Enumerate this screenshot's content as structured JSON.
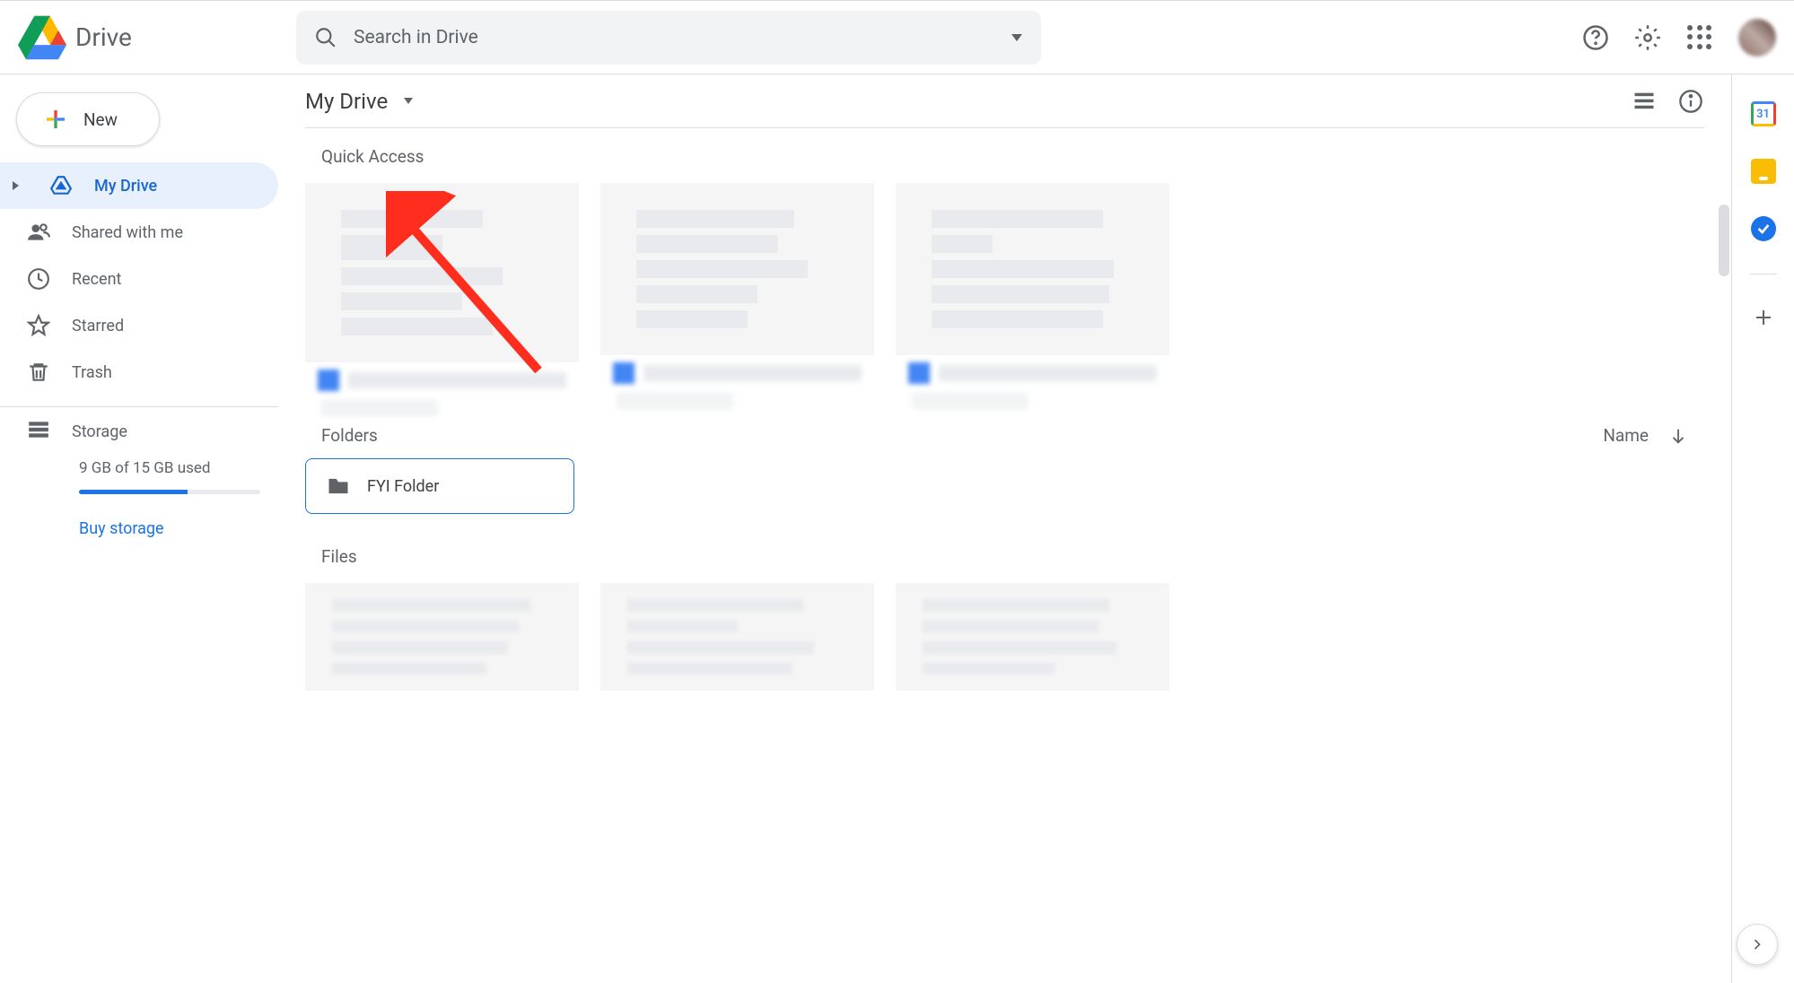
{
  "header": {
    "app_title": "Drive",
    "search_placeholder": "Search in Drive"
  },
  "sidebar": {
    "new_label": "New",
    "items": [
      {
        "label": "My Drive",
        "icon": "drive-icon",
        "active": true
      },
      {
        "label": "Shared with me",
        "icon": "people-icon"
      },
      {
        "label": "Recent",
        "icon": "clock-icon"
      },
      {
        "label": "Starred",
        "icon": "star-icon"
      },
      {
        "label": "Trash",
        "icon": "trash-icon"
      }
    ],
    "storage_label": "Storage",
    "storage_usage": "9 GB of 15 GB used",
    "storage_percent": 60,
    "buy_link": "Buy storage"
  },
  "main": {
    "breadcrumb": "My Drive",
    "quick_access_label": "Quick Access",
    "folders_label": "Folders",
    "sort_label": "Name",
    "folders": [
      {
        "name": "FYI Folder"
      }
    ],
    "files_label": "Files"
  },
  "right_panel": {
    "calendar_day": "31"
  }
}
